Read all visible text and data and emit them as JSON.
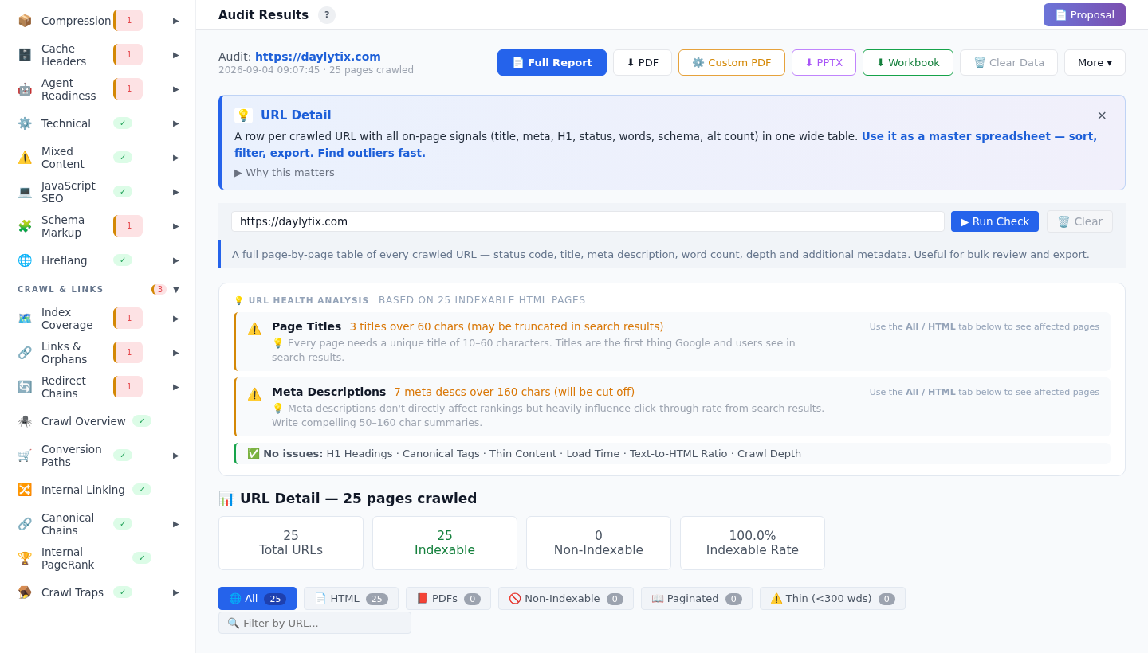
{
  "sidebar": {
    "items": [
      {
        "kind": "item",
        "icon": "📦",
        "label": "Compression",
        "badge": "1",
        "ok": false,
        "arrow": "▶"
      },
      {
        "kind": "item",
        "icon": "🗄️",
        "label": "Cache Headers",
        "badge": "1",
        "ok": false,
        "arrow": "▶"
      },
      {
        "kind": "item",
        "icon": "🤖",
        "label": "Agent Readiness",
        "badge": "1",
        "ok": false,
        "arrow": "▶"
      },
      {
        "kind": "item",
        "icon": "⚙️",
        "label": "Technical",
        "badge": "✓",
        "ok": true,
        "arrow": "▶"
      },
      {
        "kind": "item",
        "icon": "⚠️",
        "label": "Mixed Content",
        "badge": "✓",
        "ok": true,
        "arrow": "▶"
      },
      {
        "kind": "item",
        "icon": "💻",
        "label": "JavaScript SEO",
        "badge": "✓",
        "ok": true,
        "arrow": "▶"
      },
      {
        "kind": "item",
        "icon": "🧩",
        "label": "Schema Markup",
        "badge": "1",
        "ok": false,
        "arrow": "▶"
      },
      {
        "kind": "item",
        "icon": "🌐",
        "label": "Hreflang",
        "badge": "✓",
        "ok": true,
        "arrow": "▶"
      },
      {
        "kind": "section",
        "label": "CRAWL & LINKS",
        "badge": "3",
        "ok": false,
        "arrow": "▼"
      },
      {
        "kind": "item",
        "icon": "🗺️",
        "label": "Index Coverage",
        "badge": "1",
        "ok": false,
        "arrow": "▶"
      },
      {
        "kind": "item",
        "icon": "🔗",
        "label": "Links & Orphans",
        "badge": "1",
        "ok": false,
        "arrow": "▶"
      },
      {
        "kind": "item",
        "icon": "🔄",
        "label": "Redirect Chains",
        "badge": "1",
        "ok": false,
        "arrow": "▶"
      },
      {
        "kind": "item",
        "icon": "🕷️",
        "label": "Crawl Overview",
        "badge": "✓",
        "ok": true
      },
      {
        "kind": "item",
        "icon": "🛒",
        "label": "Conversion Paths",
        "badge": "✓",
        "ok": true,
        "arrow": "▶"
      },
      {
        "kind": "item",
        "icon": "🔀",
        "label": "Internal Linking",
        "badge": "✓",
        "ok": true
      },
      {
        "kind": "item",
        "icon": "🔗",
        "label": "Canonical Chains",
        "badge": "✓",
        "ok": true,
        "arrow": "▶"
      },
      {
        "kind": "item",
        "icon": "🏆",
        "label": "Internal PageRank",
        "badge": "✓",
        "ok": true
      },
      {
        "kind": "item",
        "icon": "🪤",
        "label": "Crawl Traps",
        "badge": "✓",
        "ok": true,
        "arrow": "▶"
      }
    ]
  },
  "header": {
    "title": "Audit Results",
    "help": "?",
    "proposal_button": "📄 Proposal"
  },
  "audit": {
    "label": "Audit:",
    "url": "https://daylytix.com",
    "meta": "2026-09-04 09:07:45 · 25 pages crawled"
  },
  "actions": [
    {
      "kind": "primary",
      "label": "📄 Full Report",
      "disabled": false
    },
    {
      "kind": "plain",
      "label": "⬇ PDF",
      "disabled": false
    },
    {
      "kind": "amber",
      "label": "⚙️ Custom PDF",
      "disabled": false
    },
    {
      "kind": "purple",
      "label": "⬇ PPTX",
      "disabled": false
    },
    {
      "kind": "green",
      "label": "⬇ Workbook",
      "disabled": false
    },
    {
      "kind": "plain",
      "label": "🗑️ Clear Data",
      "disabled": true
    },
    {
      "kind": "plain",
      "label": "More ▾",
      "disabled": false
    }
  ],
  "info": {
    "icon": "💡",
    "title": "URL Detail",
    "close": "×",
    "text": "A row per crawled URL with all on-page signals (title, meta, H1, status, words, schema, alt count) in one wide table. **Use it as a master spreadsheet — sort, filter, export. Find outliers fast.**",
    "toggle": "▶ Why this matters"
  },
  "check": {
    "value": "https://daylytix.com",
    "run_button": "▶ Run Check",
    "clear_button": "🗑️ Clear",
    "clear_disabled": true,
    "note": "A full page-by-page table of every crawled URL — status code, title, meta description, word count, depth and additional metadata. Useful for bulk review and export."
  },
  "health": {
    "title": "💡 URL HEALTH ANALYSIS",
    "subtitle": "BASED ON 25 INDEXABLE HTML PAGES",
    "issues": [
      {
        "icon": "⚠️",
        "name": "Page Titles",
        "summary": "3 titles over 60 chars (may be truncated in search results)",
        "tip": "💡 Every page needs a unique title of 10–60 characters. Titles are the first thing Google and users see in search results.",
        "hint": "Use the **All / HTML** tab below to see affected pages"
      },
      {
        "icon": "⚠️",
        "name": "Meta Descriptions",
        "summary": "7 meta descs over 160 chars (will be cut off)",
        "tip": "💡 Meta descriptions don't directly affect rankings but heavily influence click-through rate from search results. Write compelling 50–160 char summaries.",
        "hint": "Use the **All / HTML** tab below to see affected pages"
      }
    ],
    "ok": "✅ **No issues:** H1 Headings · Canonical Tags · Thin Content · Load Time · Text-to-HTML Ratio · Crawl Depth"
  },
  "detail": {
    "title": "📊 URL Detail — 25 pages crawled",
    "stats": [
      {
        "value": "25",
        "label": "Total URLs",
        "positive": false
      },
      {
        "value": "25",
        "label": "Indexable",
        "positive": true
      },
      {
        "value": "0",
        "label": "Non-Indexable",
        "positive": false
      },
      {
        "value": "100.0%",
        "label": "Indexable Rate",
        "positive": false
      }
    ],
    "tabs": [
      {
        "label": "🌐 All",
        "count": "25",
        "selected": true
      },
      {
        "label": "📄 HTML",
        "count": "25",
        "selected": false
      },
      {
        "label": "📕 PDFs",
        "count": "0",
        "selected": false
      },
      {
        "label": "🚫 Non-Indexable",
        "count": "0",
        "selected": false
      },
      {
        "label": "📖 Paginated",
        "count": "0",
        "selected": false
      },
      {
        "label": "⚠️ Thin (<300 wds)",
        "count": "0",
        "selected": false
      }
    ],
    "filter_placeholder": "🔍 Filter by URL..."
  }
}
